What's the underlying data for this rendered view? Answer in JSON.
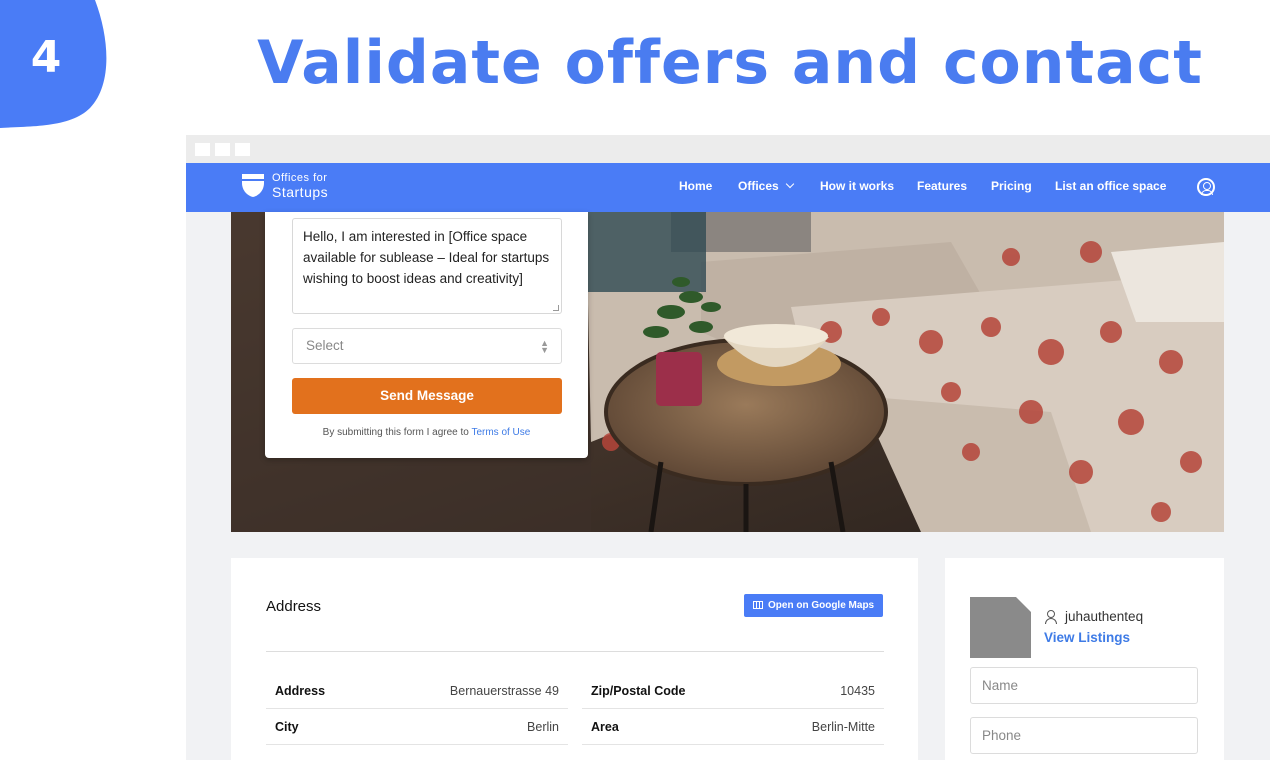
{
  "step": {
    "number": "4",
    "blob_color": "#4a7cf6"
  },
  "slide": {
    "title": "Validate offers and contact",
    "title_color": "#4a7cf0"
  },
  "navbar": {
    "logo": {
      "line1": "Offices for",
      "line2": "Startups"
    },
    "items": [
      {
        "label": "Home"
      },
      {
        "label": "Offices",
        "has_dropdown": true
      },
      {
        "label": "How it works"
      },
      {
        "label": "Features"
      },
      {
        "label": "Pricing"
      },
      {
        "label": "List an office space"
      }
    ],
    "user_icon": "user-circle-icon",
    "color": "#4a7cf6"
  },
  "contact_form": {
    "message": "Hello, I am interested in [Office space available for sublease – Ideal for startups wishing to boost ideas and creativity]",
    "select_placeholder": "Select",
    "send_label": "Send Message",
    "send_color": "#e2711d",
    "terms_prefix": "By submitting this form I agree to ",
    "terms_link": "Terms of Use"
  },
  "address": {
    "title": "Address",
    "maps_button": "Open on Google Maps",
    "left_rows": [
      {
        "key": "Address",
        "value": "Bernauerstrasse 49"
      },
      {
        "key": "City",
        "value": "Berlin"
      }
    ],
    "right_rows": [
      {
        "key": "Zip/Postal Code",
        "value": "10435"
      },
      {
        "key": "Area",
        "value": "Berlin-Mitte"
      }
    ]
  },
  "owner": {
    "username": "juhauthenteq",
    "view_listings": "View Listings",
    "name_placeholder": "Name",
    "phone_placeholder": "Phone"
  }
}
